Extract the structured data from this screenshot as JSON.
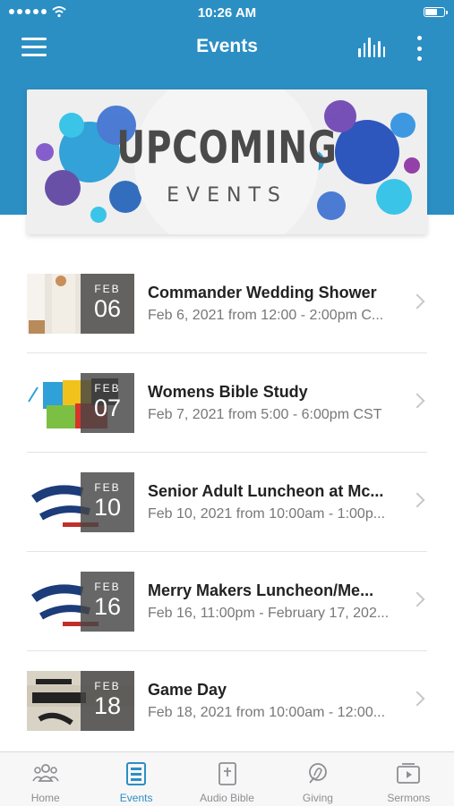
{
  "status": {
    "time": "10:26 AM"
  },
  "nav": {
    "title": "Events"
  },
  "banner": {
    "title": "UPCOMING",
    "subtitle": "EVENTS"
  },
  "events": [
    {
      "month": "FEB",
      "day": "06",
      "title": "Commander Wedding Shower",
      "subtitle": "Feb 6, 2021 from 12:00 - 2:00pm C..."
    },
    {
      "month": "FEB",
      "day": "07",
      "title": "Womens Bible Study",
      "subtitle": "Feb 7, 2021 from 5:00 - 6:00pm CST"
    },
    {
      "month": "FEB",
      "day": "10",
      "title": "Senior Adult Luncheon at Mc...",
      "subtitle": "Feb 10, 2021 from 10:00am - 1:00p..."
    },
    {
      "month": "FEB",
      "day": "16",
      "title": "Merry Makers Luncheon/Me...",
      "subtitle": "Feb 16, 11:00pm - February 17, 202..."
    },
    {
      "month": "FEB",
      "day": "18",
      "title": "Game Day",
      "subtitle": "Feb 18, 2021 from 10:00am - 12:00..."
    }
  ],
  "tabbar": {
    "home": "Home",
    "events": "Events",
    "audio_bible": "Audio Bible",
    "giving": "Giving",
    "sermons": "Sermons"
  },
  "colors": {
    "accent": "#2b8fc4",
    "date_overlay": "#464646",
    "inactive_tab": "#8e8e93"
  }
}
